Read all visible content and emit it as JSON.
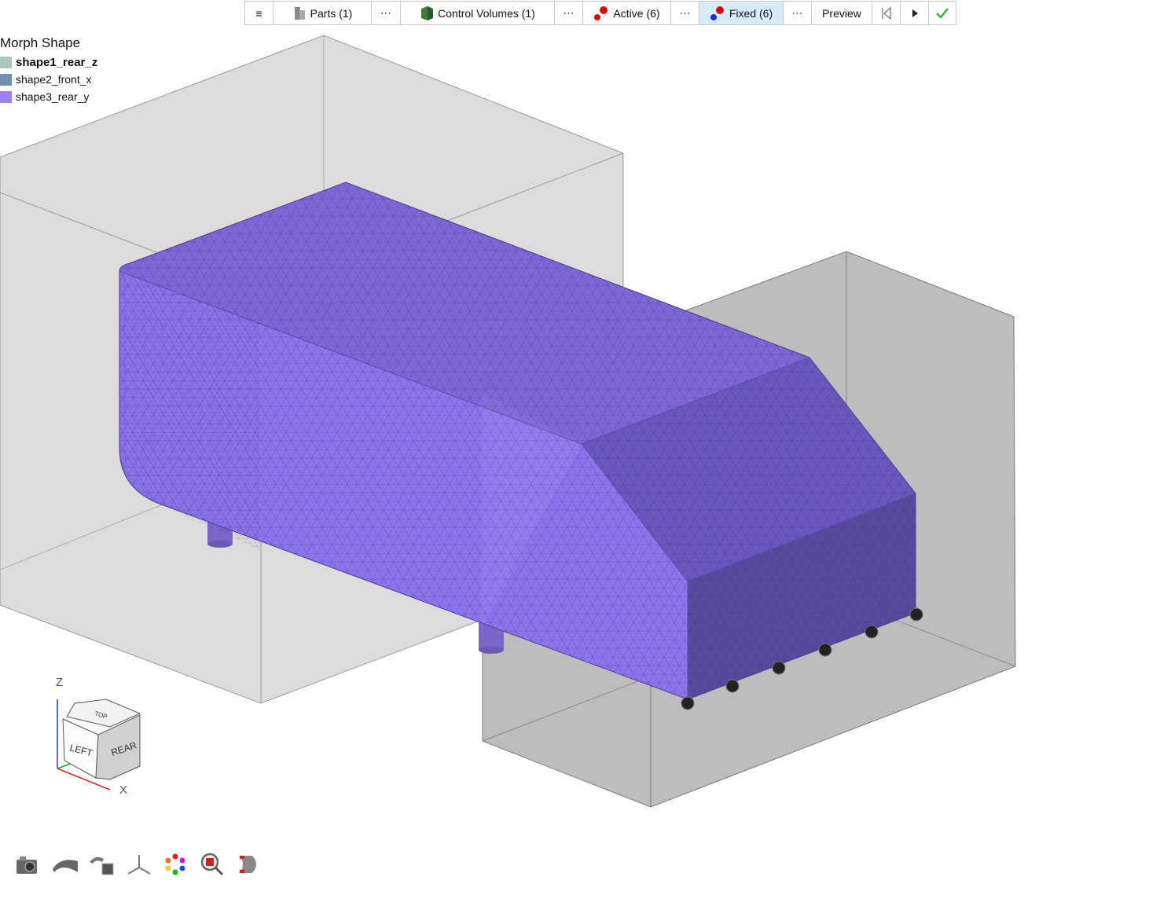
{
  "toolbar": {
    "menu_icon": "hamburger-icon",
    "parts_label": "Parts (1)",
    "control_volumes_label": "Control Volumes (1)",
    "active_label": "Active (6)",
    "fixed_label": "Fixed (6)",
    "more_label": "⋯",
    "preview_label": "Preview",
    "colors": {
      "highlight": "#d6ecf8",
      "check": "#3cb043"
    }
  },
  "legend": {
    "title": "Morph Shape",
    "items": [
      {
        "label": "shape1_rear_z",
        "color": "#a9c7bc",
        "selected": true
      },
      {
        "label": "shape2_front_x",
        "color": "#6f8fb1",
        "selected": false
      },
      {
        "label": "shape3_rear_y",
        "color": "#9a80f2",
        "selected": false
      }
    ]
  },
  "viewcube": {
    "z_label": "Z",
    "x_label": "X",
    "top": "TOP",
    "left": "LEFT",
    "rear": "REAR"
  },
  "bottom_tools": [
    "camera-icon",
    "surface-icon",
    "shape-to-cube-icon",
    "axis-triad-icon",
    "color-wheel-icon",
    "zoom-box-icon",
    "part-view-icon"
  ]
}
